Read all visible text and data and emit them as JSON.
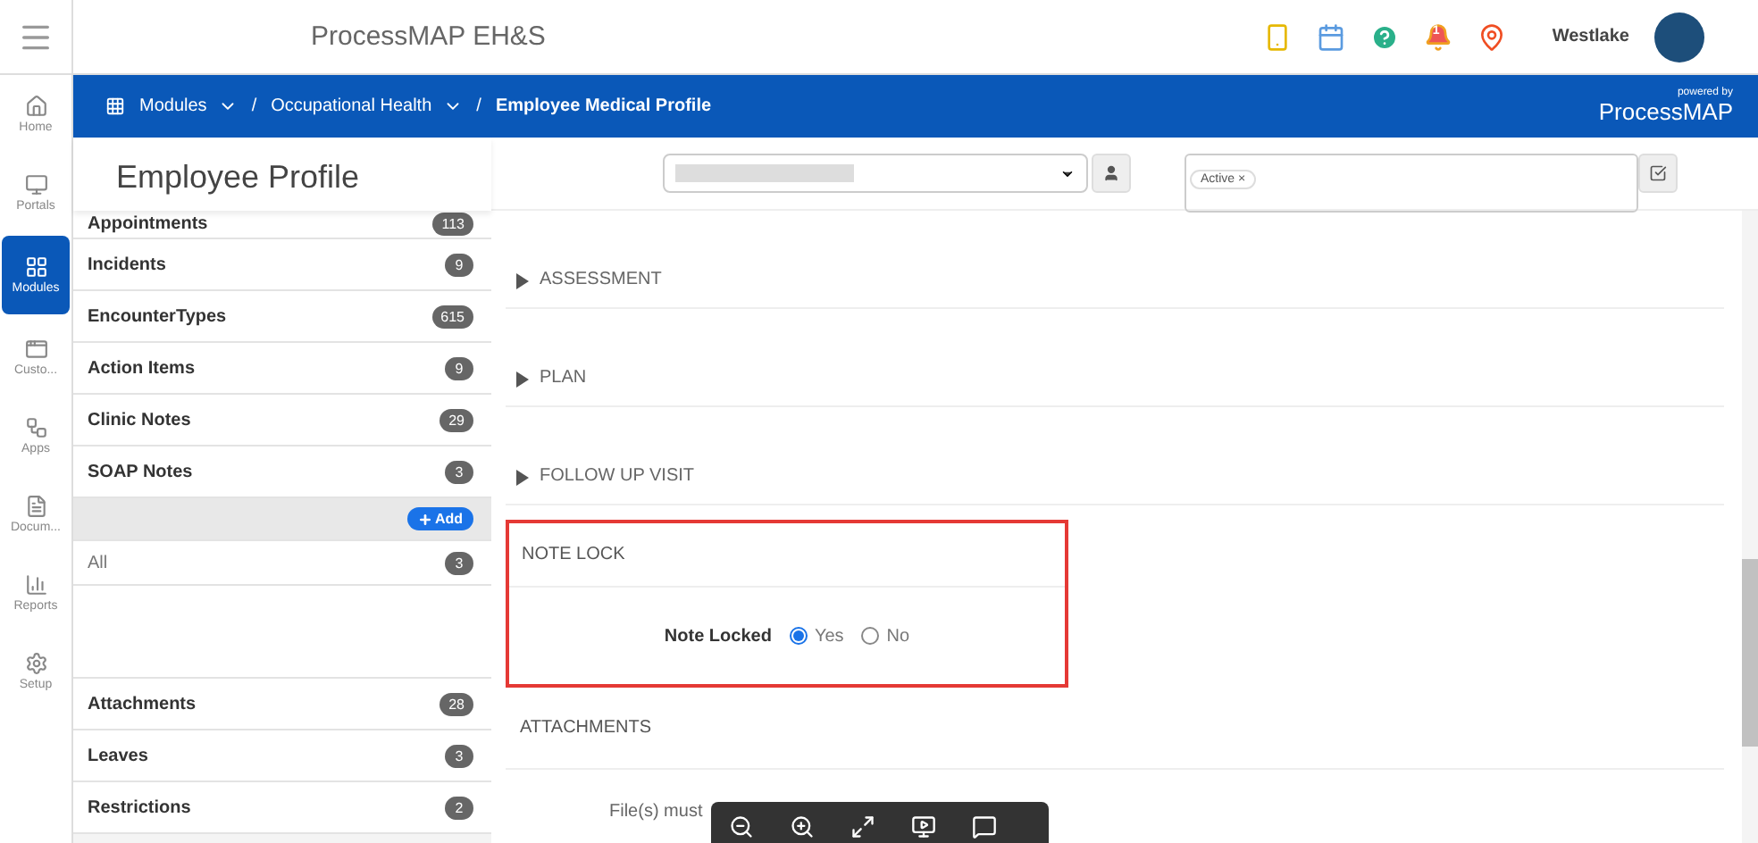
{
  "app_title": "ProcessMAP EH&S",
  "user": {
    "name": "Westlake"
  },
  "notification_count": "1",
  "rail": [
    {
      "label": "Home",
      "selected": false
    },
    {
      "label": "Portals",
      "selected": false
    },
    {
      "label": "Modules",
      "selected": true
    },
    {
      "label": "Custo...",
      "selected": false
    },
    {
      "label": "Apps",
      "selected": false
    },
    {
      "label": "Docum...",
      "selected": false
    },
    {
      "label": "Reports",
      "selected": false
    },
    {
      "label": "Setup",
      "selected": false
    }
  ],
  "breadcrumb": [
    {
      "label": "Modules",
      "dropdown": true
    },
    {
      "separator": "/",
      "label": "Occupational Health",
      "dropdown": true
    },
    {
      "separator": "/",
      "label": "Employee Medical Profile",
      "dropdown": false
    }
  ],
  "powered_by": {
    "caption": "powered by",
    "brand_light": "Process",
    "brand_bold": "MAP"
  },
  "page_title": "Employee Profile",
  "filter_tag": {
    "label": "Active",
    "remove": "×"
  },
  "side_list": [
    {
      "label": "Appointments",
      "count": "113",
      "kind": "item"
    },
    {
      "label": "Incidents",
      "count": "9",
      "kind": "item"
    },
    {
      "label": "EncounterTypes",
      "count": "615",
      "kind": "item"
    },
    {
      "label": "Action Items",
      "count": "9",
      "kind": "item"
    },
    {
      "label": "Clinic Notes",
      "count": "29",
      "kind": "item"
    },
    {
      "label": "SOAP Notes",
      "count": "3",
      "kind": "item"
    },
    {
      "label": "Add",
      "kind": "add"
    },
    {
      "label": "All",
      "count": "3",
      "kind": "sub"
    },
    {
      "kind": "spacer"
    },
    {
      "label": "Attachments",
      "count": "28",
      "kind": "item"
    },
    {
      "label": "Leaves",
      "count": "3",
      "kind": "item"
    },
    {
      "label": "Restrictions",
      "count": "2",
      "kind": "item"
    }
  ],
  "sections": [
    {
      "title": "ASSESSMENT",
      "collapsible": true
    },
    {
      "title": "PLAN",
      "collapsible": true
    },
    {
      "title": "FOLLOW UP VISIT",
      "collapsible": true
    }
  ],
  "note_lock": {
    "title": "NOTE LOCK",
    "field_label": "Note Locked",
    "options": [
      {
        "label": "Yes",
        "selected": true
      },
      {
        "label": "No",
        "selected": false
      }
    ]
  },
  "attachments": {
    "title": "ATTACHMENTS",
    "hint": "File(s) must"
  }
}
